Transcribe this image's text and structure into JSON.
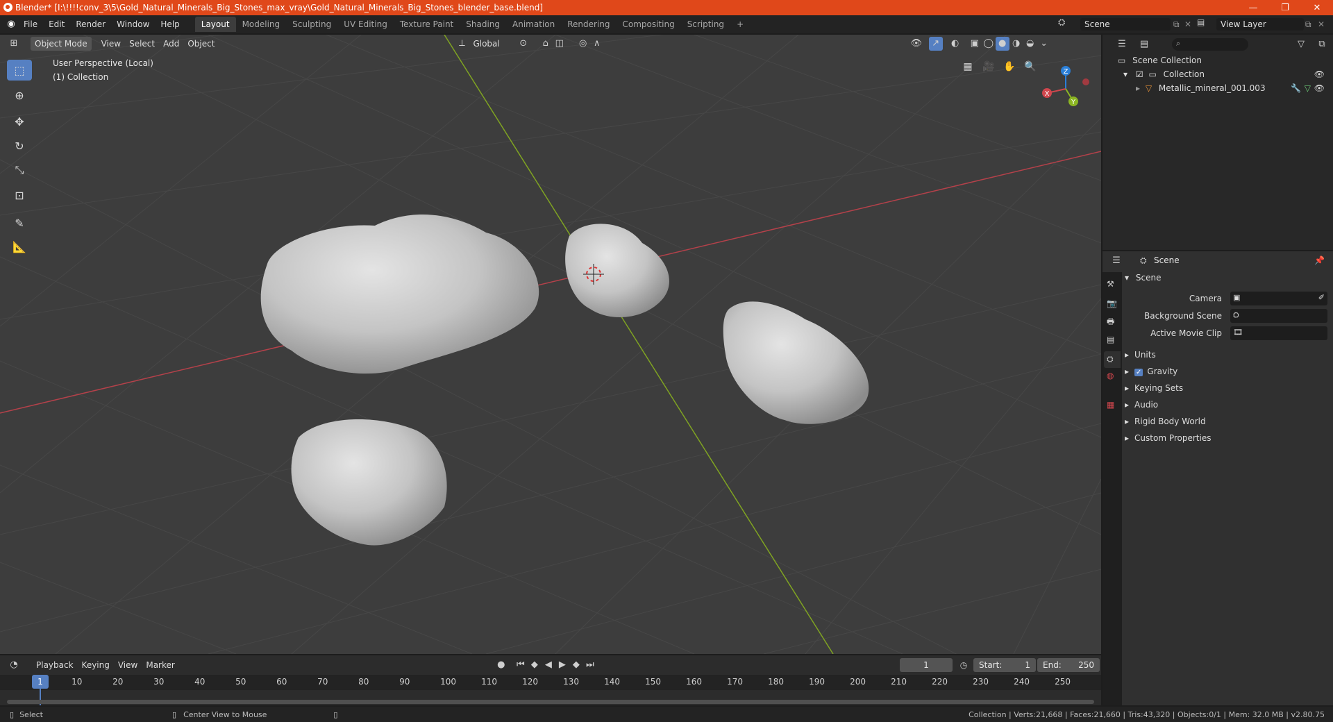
{
  "window": {
    "title": "Blender* [I:\\!!!!conv_3\\5\\Gold_Natural_Minerals_Big_Stones_max_vray\\Gold_Natural_Minerals_Big_Stones_blender_base.blend]",
    "minimize": "—",
    "maximize": "❐",
    "close": "✕"
  },
  "menu": [
    "File",
    "Edit",
    "Render",
    "Window",
    "Help"
  ],
  "workspaces": [
    "Layout",
    "Modeling",
    "Sculpting",
    "UV Editing",
    "Texture Paint",
    "Shading",
    "Animation",
    "Rendering",
    "Compositing",
    "Scripting"
  ],
  "workspace_add": "+",
  "scene_selector": {
    "value": "Scene"
  },
  "view_layer_selector": {
    "value": "View Layer"
  },
  "viewport": {
    "mode": "Object Mode",
    "menus": [
      "View",
      "Select",
      "Add",
      "Object"
    ],
    "orientation": "Global",
    "overlay_line1": "User Perspective (Local)",
    "overlay_line2": "(1) Collection",
    "gizmo": {
      "x": "X",
      "y": "Y",
      "z": "Z"
    }
  },
  "outliner": {
    "search_placeholder": "",
    "root": "Scene Collection",
    "collection": "Collection",
    "object": "Metallic_mineral_001.003"
  },
  "properties": {
    "context": "Scene",
    "panel": "Scene",
    "fields": [
      {
        "label": "Camera",
        "value": ""
      },
      {
        "label": "Background Scene",
        "value": ""
      },
      {
        "label": "Active Movie Clip",
        "value": ""
      }
    ],
    "sections": [
      "Units",
      "Gravity",
      "Keying Sets",
      "Audio",
      "Rigid Body World",
      "Custom Properties"
    ],
    "gravity_checked": true
  },
  "timeline": {
    "menus": [
      "Playback",
      "Keying",
      "View",
      "Marker"
    ],
    "current_frame": "1",
    "start_label": "Start:",
    "start": "1",
    "end_label": "End:",
    "end": "250",
    "ticks": [
      "1",
      "10",
      "20",
      "30",
      "40",
      "50",
      "60",
      "70",
      "80",
      "90",
      "100",
      "110",
      "120",
      "130",
      "140",
      "150",
      "160",
      "170",
      "180",
      "190",
      "200",
      "210",
      "220",
      "230",
      "240",
      "250"
    ]
  },
  "status": {
    "select": "Select",
    "center": "Center View to Mouse",
    "stats": "Collection | Verts:21,668 | Faces:21,660 | Tris:43,320 | Objects:0/1 | Mem: 32.0 MB | v2.80.75"
  },
  "colors": {
    "accent": "#5680c2",
    "titlebar": "#e0481a",
    "x_axis": "#d0464d",
    "y_axis": "#8cb623"
  }
}
